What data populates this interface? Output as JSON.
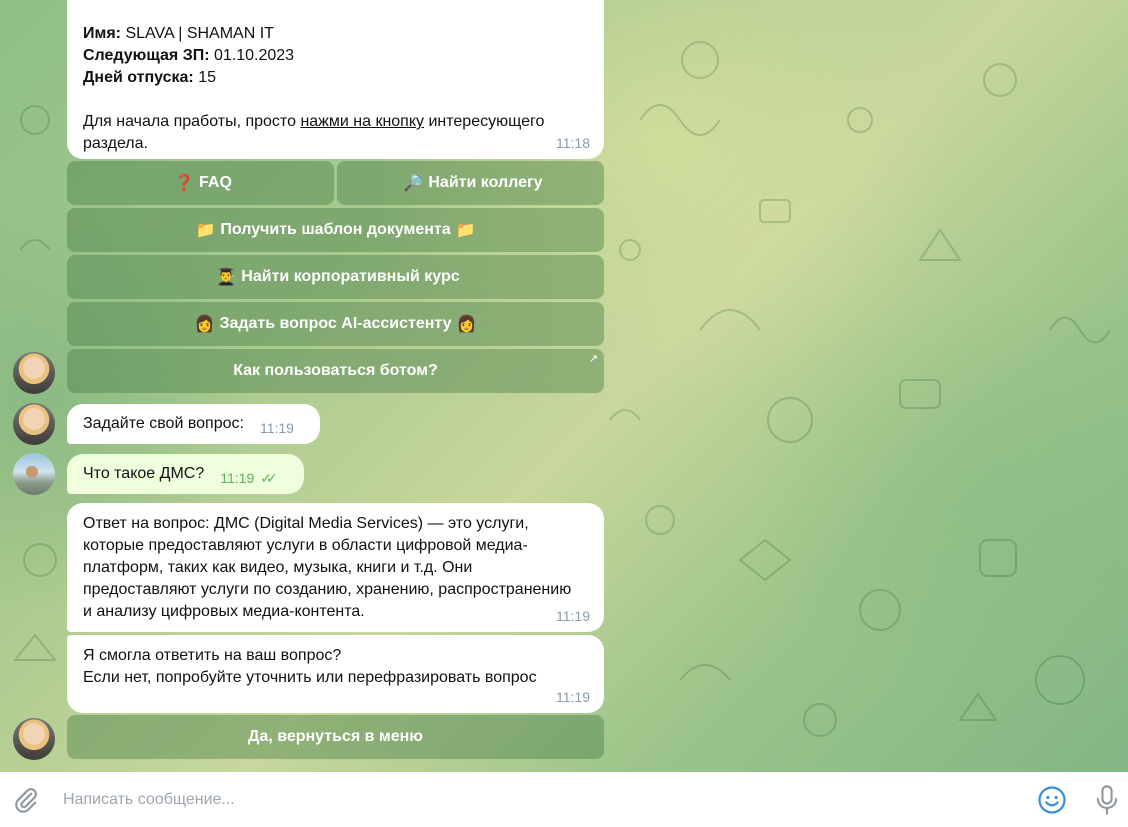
{
  "messages": {
    "welcome": {
      "name_label": "Имя:",
      "name_value": "SLAVA | SHAMAN IT",
      "salary_label": "Следующая ЗП:",
      "salary_value": "01.10.2023",
      "vacation_label": "Дней отпуска:",
      "vacation_value": "15",
      "intro_before": "Для начала пработы, просто",
      "intro_link": "нажми на кнопку",
      "intro_after": "интересующего раздела.",
      "time": "11:18"
    },
    "ask_prompt": {
      "text": "Задайте свой вопрос:",
      "time": "11:19"
    },
    "user_question": {
      "text": "Что такое ДМС?",
      "time": "11:19"
    },
    "answer": {
      "text": "Ответ на вопрос: ДМС (Digital Media Services) — это услуги, которые предоставляют услуги в области цифровой медиа-платформ, таких как видео, музыка, книги и т.д. Они предоставляют услуги по созданию, хранению, распространению и анализу цифровых медиа-контента.",
      "time": "11:19"
    },
    "followup": {
      "line1": "Я смогла ответить на ваш вопрос?",
      "line2": "Если нет, попробуйте уточнить или перефразировать вопрос",
      "time": "11:19"
    }
  },
  "keyboard": {
    "faq": {
      "emoji": "❓",
      "label": "FAQ"
    },
    "find_colleague": {
      "emoji": "🔎",
      "label": "Найти коллегу"
    },
    "get_template": {
      "emoji": "📁",
      "label": "Получить шаблон документа",
      "emoji_after": "📁"
    },
    "find_course": {
      "emoji": "👨‍🎓",
      "label": "Найти корпоративный курс"
    },
    "ask_ai": {
      "emoji": "👩",
      "label": "Задать вопрос AI-ассистенту",
      "emoji_after": "👩"
    },
    "how_to_use": {
      "label": "Как пользоваться ботом?",
      "arrow": "↗"
    },
    "back_to_menu": {
      "label": "Да, вернуться в меню"
    }
  },
  "composer": {
    "placeholder": "Написать сообщение...",
    "icons": [
      "paperclip-icon",
      "emoji-icon",
      "microphone-icon"
    ]
  },
  "colors": {
    "incoming_bubble": "#ffffff",
    "outgoing_bubble": "#effedd",
    "read_check": "#5fb257",
    "keyboard_button": "#467d46"
  }
}
